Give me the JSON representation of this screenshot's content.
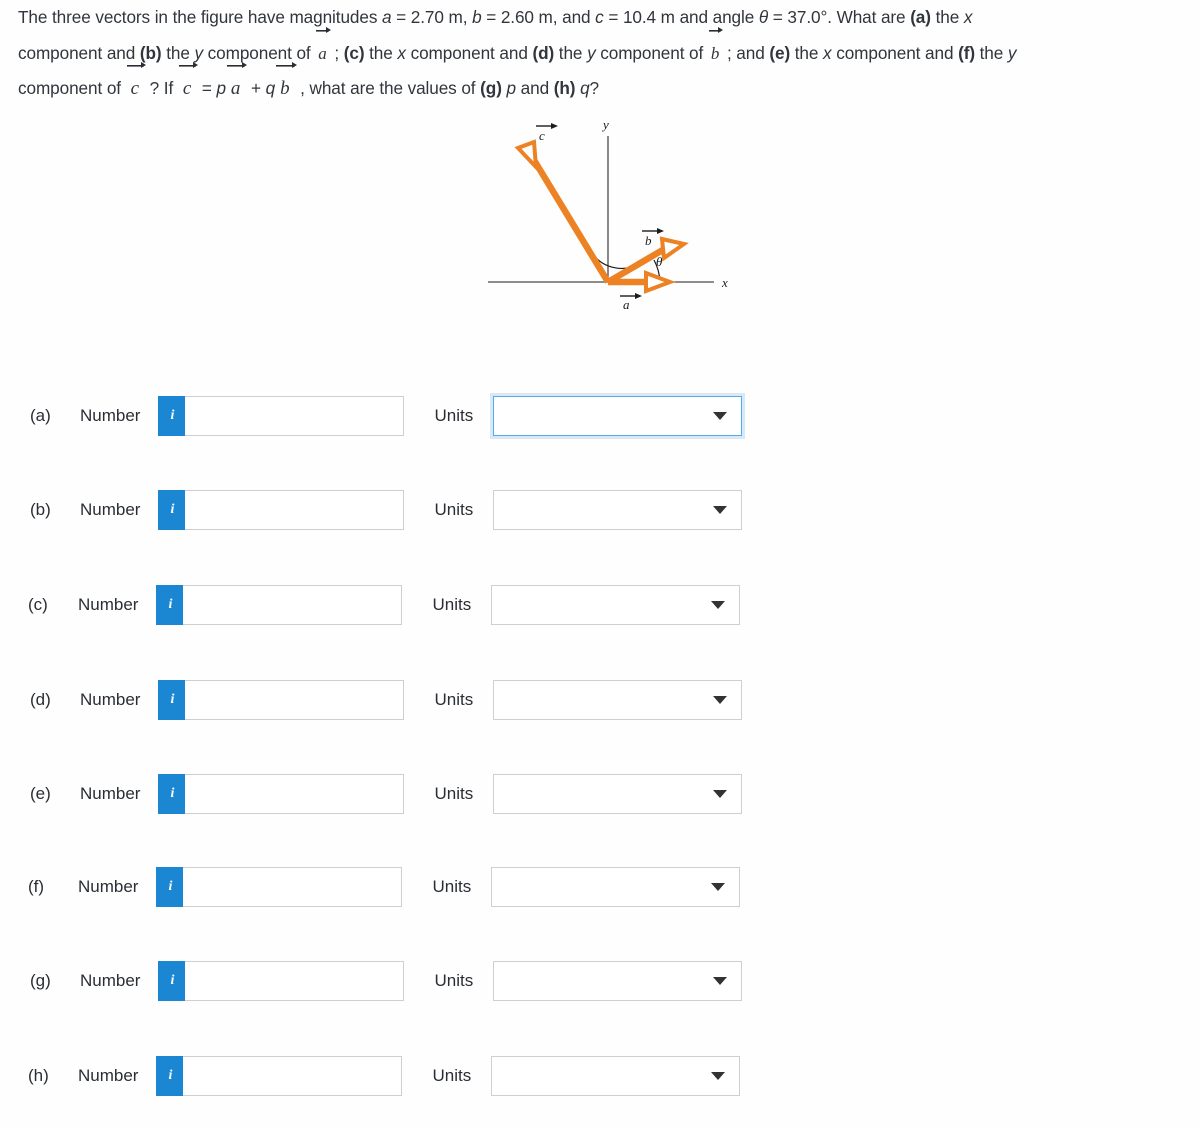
{
  "problem": {
    "line1_a": "The three vectors in the figure have magnitudes ",
    "mag_a_label": "a",
    "mag_a_eq": " = 2.70 m, ",
    "mag_b_label": "b",
    "mag_b_eq": " = 2.60 m, and ",
    "mag_c_label": "c",
    "mag_c_eq": " = 10.4 m and angle ",
    "theta_sym": "θ",
    "theta_eq": " = 37.0°. What are ",
    "part_a": "(a)",
    "line1_tail": " the ",
    "x_sym": "x",
    "line2_a": "component and ",
    "part_b": "(b)",
    "line2_b": " the ",
    "y_sym": "y",
    "line2_c": " component of ",
    "vec_a": "a",
    "line2_d": " ; ",
    "part_c": "(c)",
    "line2_e": " the ",
    "line2_f": " component and ",
    "part_d": "(d)",
    "line2_g": " the ",
    "line2_h": " component of ",
    "vec_b": "b",
    "line2_i": " ; and ",
    "part_e": "(e)",
    "line2_j": " the ",
    "line2_k": " component and ",
    "part_f": "(f)",
    "line2_l": " the ",
    "line3_a": "component of ",
    "vec_c": "c",
    "line3_b": " ? If ",
    "line3_eq": " = ",
    "p_sym": "p",
    "plus_sym": " + ",
    "q_sym": "q",
    "line3_c": " , what are the values of ",
    "part_g": "(g)",
    "line3_d": " and ",
    "part_h": "(h)",
    "question_mark": "?"
  },
  "figure": {
    "axis_x_label": "x",
    "axis_y_label": "y",
    "vector_a_label": "a",
    "vector_b_label": "b",
    "vector_c_label": "c",
    "angle_theta_label": "θ",
    "vector_color": "#ec8224",
    "axis_color": "#4a4a4a",
    "label_color": "#1c1c1c"
  },
  "answers": {
    "number_label": "Number",
    "units_label": "Units",
    "info_glyph": "i",
    "rows": [
      {
        "key": "a",
        "label": "(a)",
        "number_value": "",
        "units_value": "",
        "focused": true
      },
      {
        "key": "b",
        "label": "(b)",
        "number_value": "",
        "units_value": "",
        "focused": false
      },
      {
        "key": "c",
        "label": "(c)",
        "number_value": "",
        "units_value": "",
        "focused": false
      },
      {
        "key": "d",
        "label": "(d)",
        "number_value": "",
        "units_value": "",
        "focused": false
      },
      {
        "key": "e",
        "label": "(e)",
        "number_value": "",
        "units_value": "",
        "focused": false
      },
      {
        "key": "f",
        "label": "(f)",
        "number_value": "",
        "units_value": "",
        "focused": false
      },
      {
        "key": "g",
        "label": "(g)",
        "number_value": "",
        "units_value": "",
        "focused": false
      },
      {
        "key": "h",
        "label": "(h)",
        "number_value": "",
        "units_value": "",
        "focused": false
      }
    ]
  },
  "colors": {
    "accent_blue": "#1b87d2",
    "focus_blue": "#5aa9e6",
    "border_gray": "#cfcfcf",
    "vector_orange": "#ec8224",
    "text": "#2a2e34"
  }
}
